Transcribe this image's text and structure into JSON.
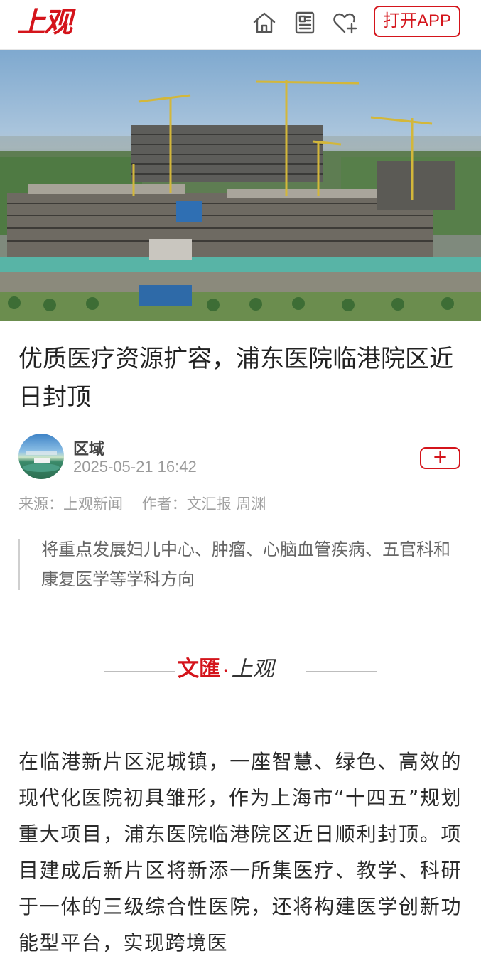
{
  "header": {
    "logo_text": "上观",
    "open_app_label": "打开APP",
    "icons": [
      "home-icon",
      "newspaper-icon",
      "heart-add-icon"
    ]
  },
  "colors": {
    "brand_red": "#d4141b",
    "muted_gray": "#9a9a9a"
  },
  "article": {
    "title": "优质医疗资源扩容，浦东医院临港院区近日封顶",
    "author_name": "区域",
    "published_time": "2025-05-21 16:42",
    "follow_label": "+",
    "source_label": "来源：",
    "source_value": "上观新闻",
    "author_label": "作者：",
    "author_value": "文汇报 周渊",
    "summary": "将重点发展妇儿中心、肿瘤、心脑血管疾病、五官科和康复医学等学科方向",
    "brand_left": "文匯",
    "brand_dot": "·",
    "brand_right": "上观",
    "body": "在临港新片区泥城镇，一座智慧、绿色、高效的现代化医院初具雏形，作为上海市“十四五”规划重大项目，浦东医院临港院区近日顺利封顶。项目建成后新片区将新添一所集医疗、教学、科研于一体的三级综合性医院，还将构建医学创新功能型平台，实现跨境医"
  }
}
